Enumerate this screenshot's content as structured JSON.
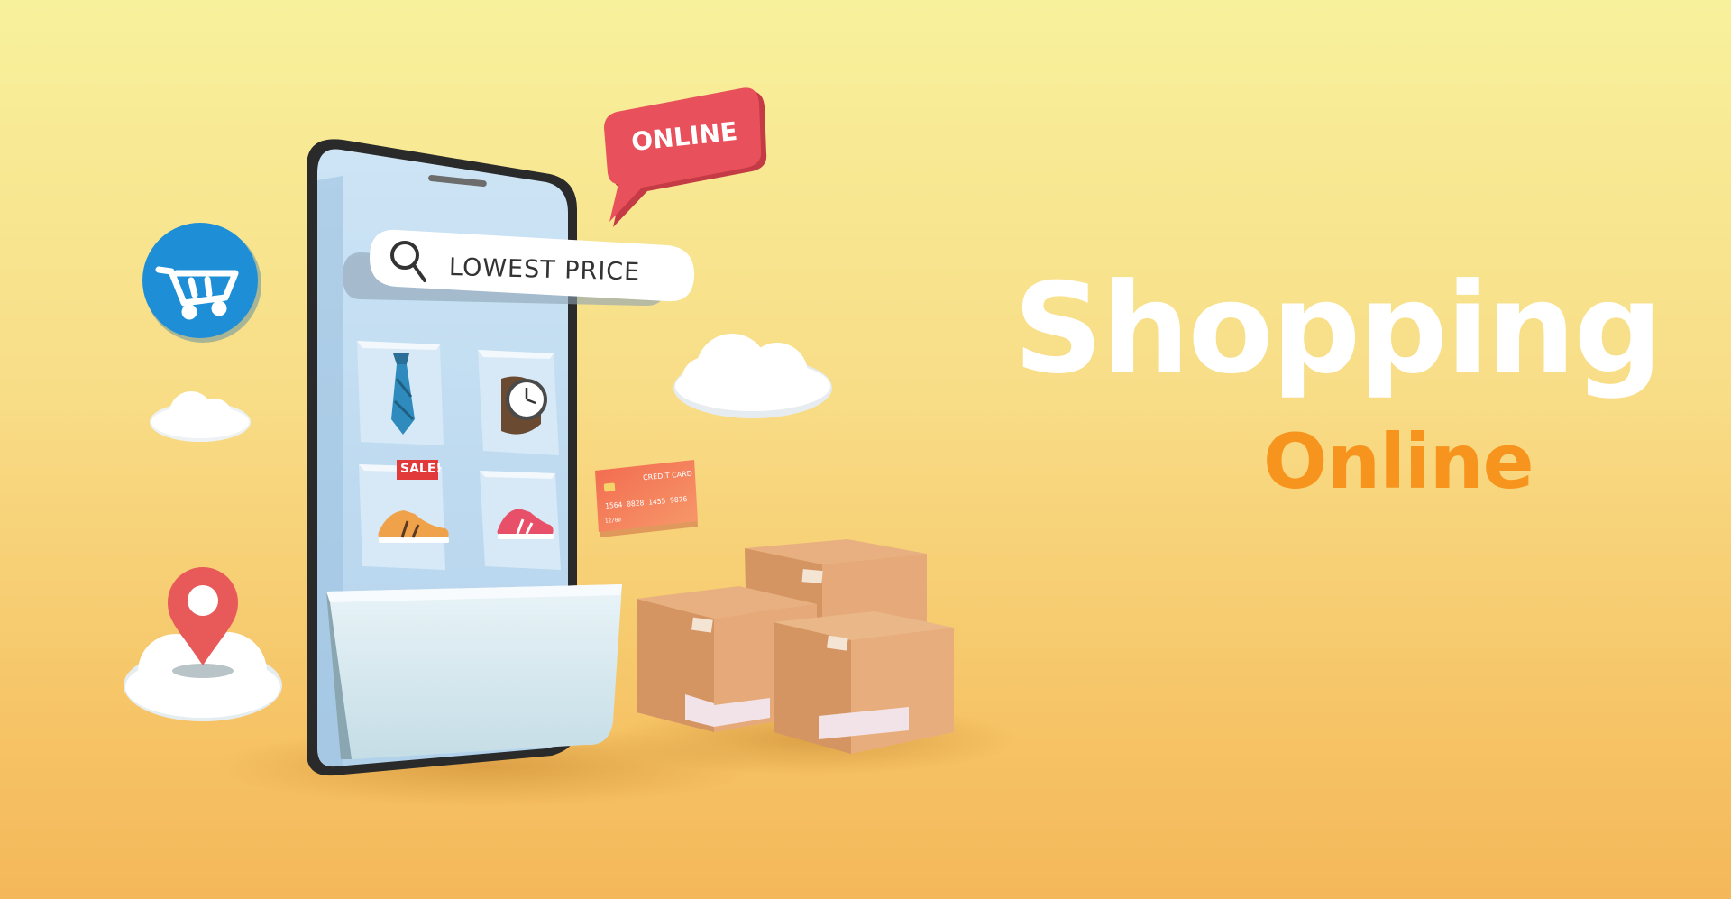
{
  "headline": {
    "title": "Shopping",
    "subtitle": "Online"
  },
  "phone": {
    "search_text": "LOWEST PRICE",
    "sale_tag": "SALE!"
  },
  "bubble": {
    "text": "ONLINE"
  },
  "credit_card": {
    "label": "CREDIT CARD",
    "number": "1564 0828 1455 9876",
    "expiry": "12/00"
  },
  "icons": [
    "cart-icon",
    "location-pin-icon",
    "search-icon",
    "tie-icon",
    "watch-icon",
    "sneaker-icon",
    "box-icon",
    "cloud-icon"
  ],
  "colors": {
    "background_top": "#f8f19c",
    "background_bottom": "#f4b85a",
    "headline": "#ffffff",
    "subheadline": "#f7941e",
    "bubble": "#e8505b",
    "cart_badge": "#1e8fd6",
    "pin": "#e85a5a",
    "box": "#d99a66"
  }
}
